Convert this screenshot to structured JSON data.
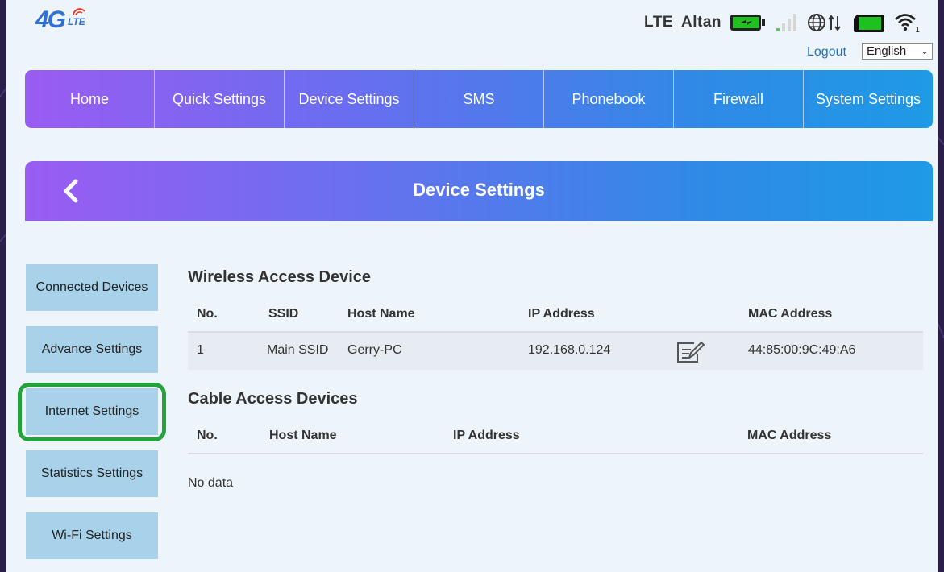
{
  "header": {
    "logo_main": "4G",
    "logo_sub": "LTE",
    "network_type": "LTE",
    "carrier": "Altan",
    "logout_label": "Logout",
    "language_selected": "English"
  },
  "status_icons": [
    "battery-charging-icon",
    "signal-bars-icon",
    "globe-data-icon",
    "sim-icon",
    "wifi-icon"
  ],
  "nav": {
    "items": [
      "Home",
      "Quick Settings",
      "Device Settings",
      "SMS",
      "Phonebook",
      "Firewall",
      "System Settings"
    ]
  },
  "page": {
    "title": "Device Settings"
  },
  "sidebar": {
    "items": [
      "Connected Devices",
      "Advance Settings",
      "Internet Settings",
      "Statistics Settings",
      "Wi-Fi Settings"
    ]
  },
  "wireless": {
    "title": "Wireless Access Device",
    "headers": [
      "No.",
      "SSID",
      "Host Name",
      "IP Address",
      "MAC Address"
    ],
    "rows": [
      {
        "no": "1",
        "ssid": "Main SSID",
        "host": "Gerry-PC",
        "ip": "192.168.0.124",
        "mac": "44:85:00:9C:49:A6"
      }
    ]
  },
  "cable": {
    "title": "Cable Access Devices",
    "headers": [
      "No.",
      "Host Name",
      "IP Address",
      "MAC Address"
    ],
    "empty_text": "No data"
  },
  "colors": {
    "nav_gradient_start": "#9a5cf2",
    "nav_gradient_end": "#1e9ae6",
    "sidebar_button": "#a8d2ea",
    "highlight": "#23a33c",
    "battery": "#1ec21e"
  }
}
